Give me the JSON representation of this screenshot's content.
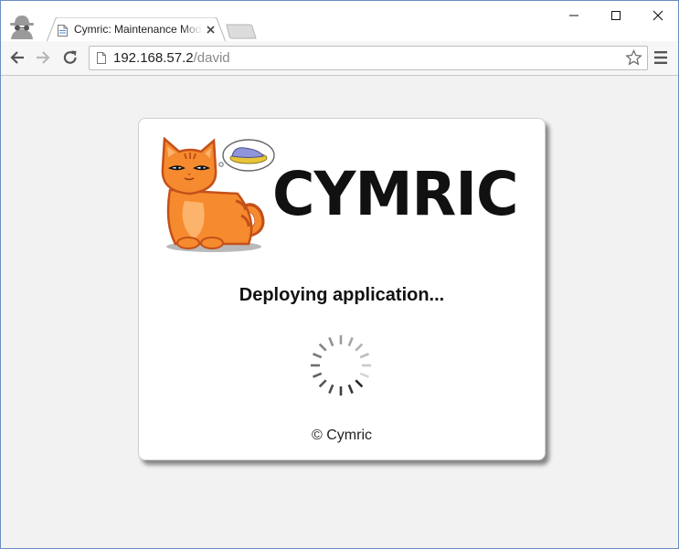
{
  "browser": {
    "tab": {
      "title": "Cymric: Maintenance Mode",
      "favicon": "page-icon"
    },
    "address_bar": {
      "host": "192.168.57.2",
      "path": "/david"
    },
    "icons": {
      "incognito": "incognito-icon",
      "back": "back-arrow-icon",
      "forward": "forward-arrow-icon",
      "reload": "reload-icon",
      "bookmark": "star-icon",
      "menu": "hamburger-menu-icon",
      "minimize": "minimize-icon",
      "maximize": "maximize-icon",
      "close": "close-icon"
    }
  },
  "page": {
    "brand": "CYMRIC",
    "status_text": "Deploying application...",
    "footer": "© Cymric",
    "colors": {
      "cat_orange": "#f68a2e",
      "cat_outline": "#c4501a",
      "slipper_blue": "#8e95d9",
      "text": "#111111"
    }
  }
}
